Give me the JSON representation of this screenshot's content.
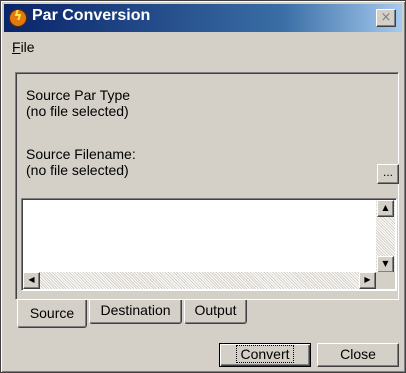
{
  "window": {
    "title": "Par Conversion",
    "app_icon": "lightning-icon",
    "close_glyph": "×"
  },
  "menu": {
    "file_label_rest": "ile",
    "file_accel": "F"
  },
  "source": {
    "par_type_label": "Source Par Type",
    "par_type_value": "(no file selected)",
    "filename_label": "Source Filename:",
    "filename_value": "(no file selected)",
    "browse_label": "..."
  },
  "textbox": {
    "content": ""
  },
  "tabs": [
    {
      "label": "Source",
      "active": true
    },
    {
      "label": "Destination",
      "active": false
    },
    {
      "label": "Output",
      "active": false
    }
  ],
  "buttons": {
    "convert": "Convert",
    "close": "Close"
  },
  "colors": {
    "titlebar_start": "#0a246a",
    "titlebar_end": "#a6caf0",
    "face": "#d4d0c8"
  }
}
